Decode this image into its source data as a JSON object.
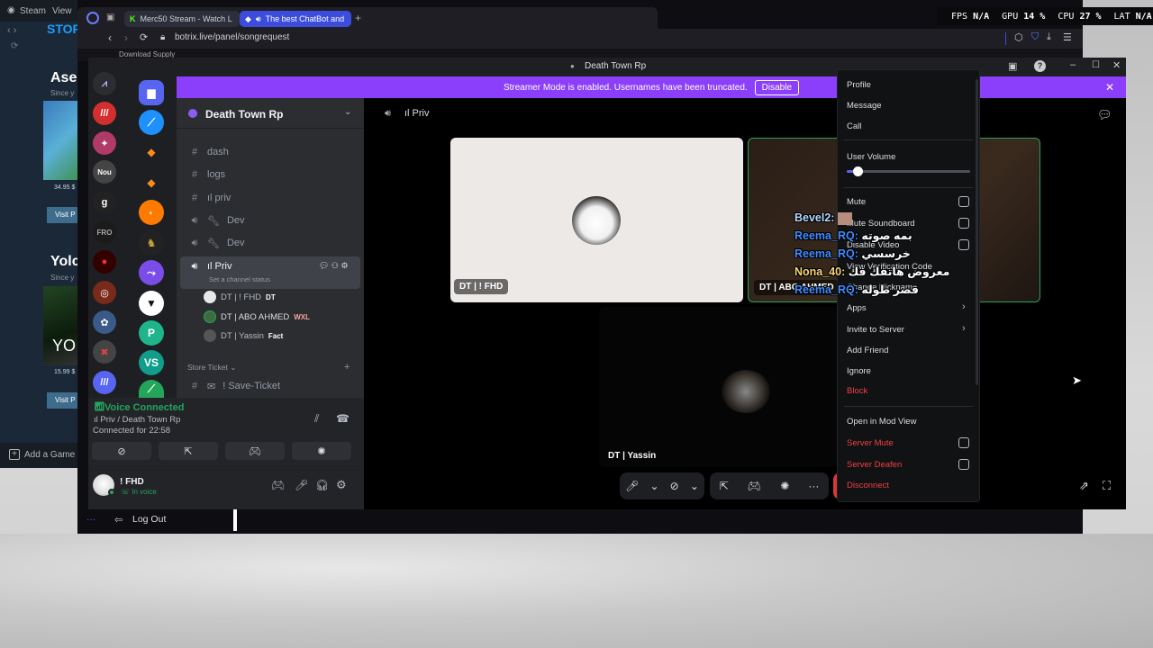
{
  "colors": {
    "accent_purple": "#8b3ffb",
    "steam_blue": "#1a9fff",
    "danger_red": "#f23f43",
    "voice_green": "#23a55a",
    "discord_dark": "#1e1f22",
    "sidebar": "#2b2d31"
  },
  "steam": {
    "title": "Steam",
    "menu_view": "View",
    "store": "STORE",
    "game1_title": "Ase",
    "game1_since": "Since y",
    "game1_price": "34.95 $",
    "visit1": "Visit P",
    "game2_title": "Yolc",
    "game2_since": "Since y",
    "game2_price": "15.99 $",
    "visit2": "Visit P",
    "add_game": "Add a Game"
  },
  "browser": {
    "tabs": [
      {
        "label": "Merc50 Stream - Watch L"
      },
      {
        "label": "The best ChatBot and"
      }
    ],
    "url": "botrix.live/panel/songrequest",
    "download_item": "Download Supply"
  },
  "hud": {
    "fps_label": "FPS",
    "fps_value": "N/A",
    "gpu_label": "GPU",
    "gpu_value": "14 %",
    "cpu_label": "CPU",
    "cpu_value": "27 %",
    "lat_label": "LAT",
    "lat_value": "N/A"
  },
  "discord": {
    "window_title": "Death Town Rp",
    "streamer_mode_text": "Streamer Mode is enabled. Usernames have been truncated.",
    "disable_label": "Disable",
    "server_name": "Death Town Rp",
    "channels": [
      {
        "name": "dash",
        "type": "text"
      },
      {
        "name": "logs",
        "type": "text"
      },
      {
        "name": "ıl priv",
        "type": "text"
      },
      {
        "name": "Dev",
        "type": "voice"
      },
      {
        "name": "Dev",
        "type": "voice"
      },
      {
        "name": "ıl Priv",
        "type": "voice",
        "status": "Set a channel status"
      }
    ],
    "members": [
      {
        "name": "DT | ! FHD",
        "tag": "DT"
      },
      {
        "name": "DT | ABO AHMED",
        "tag": "WXL"
      },
      {
        "name": "DT | Yassin",
        "tag": "Fact"
      }
    ],
    "category": "Store Ticket",
    "ticket_channel": "! Save-Ticket",
    "voice_connected": "Voice Connected",
    "voice_location": "ıl Priv / Death Town Rp",
    "connected_for": "Connected for 22:58",
    "user_name": "! FHD",
    "user_status": "In voice",
    "log_out": "Log Out",
    "stage_channel": "ıl Priv",
    "tile1_label": "DT | ! FHD",
    "tile2_label": "DT | ABO AHMED",
    "tile3_label": "DT | Yassin"
  },
  "chat_overlay": [
    {
      "user": "Bevel2:",
      "msg": ""
    },
    {
      "user": "Reema_RQ:",
      "msg": "بمه صوته"
    },
    {
      "user": "Reema_RQ:",
      "msg": "خرسسي"
    },
    {
      "user": "Nona_40:",
      "msg": "معروض هاتفك فك"
    },
    {
      "user": "Reema_RQ:",
      "msg": "قصر طوله"
    }
  ],
  "context_menu": {
    "profile": "Profile",
    "message": "Message",
    "call": "Call",
    "user_volume": "User Volume",
    "volume_level": 0.05,
    "mute": "Mute",
    "mute_soundboard": "Mute Soundboard",
    "disable_video": "Disable Video",
    "view_verification": "View Verification Code",
    "change_nickname": "Change Nickname",
    "apps": "Apps",
    "invite": "Invite to Server",
    "add_friend": "Add Friend",
    "ignore": "Ignore",
    "block": "Block",
    "open_mod_view": "Open in Mod View",
    "server_mute": "Server Mute",
    "server_deafen": "Server Deafen",
    "disconnect": "Disconnect"
  }
}
